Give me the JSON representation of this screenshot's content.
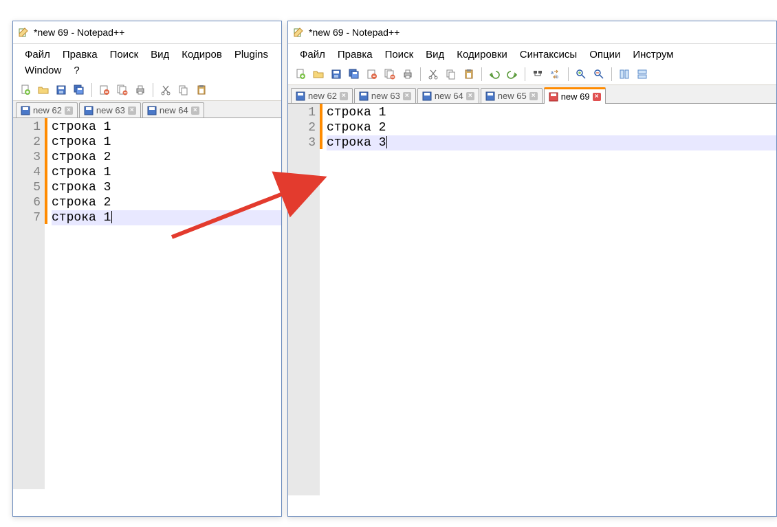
{
  "app": {
    "title": "*new 69 - Notepad++"
  },
  "menu": {
    "file": "Файл",
    "edit": "Правка",
    "search": "Поиск",
    "view": "Вид",
    "encoding_short": "Кодиров",
    "encoding": "Кодировки",
    "syntax": "Синтаксисы",
    "options": "Опции",
    "tools_trunc": "Инструм",
    "plugins": "Plugins",
    "window": "Window",
    "help": "?"
  },
  "tabs": {
    "t62": "new 62",
    "t63": "new 63",
    "t64": "new 64",
    "t65": "new 65",
    "t69": "new 69"
  },
  "left_lines": {
    "n1": "1",
    "l1": "строка 1",
    "n2": "2",
    "l2": "строка 1",
    "n3": "3",
    "l3": "строка 2",
    "n4": "4",
    "l4": "строка 1",
    "n5": "5",
    "l5": "строка 3",
    "n6": "6",
    "l6": "строка 2",
    "n7": "7",
    "l7": "строка 1"
  },
  "right_lines": {
    "n1": "1",
    "l1": "строка 1",
    "n2": "2",
    "l2": "строка 2",
    "n3": "3",
    "l3": "строка 3"
  }
}
